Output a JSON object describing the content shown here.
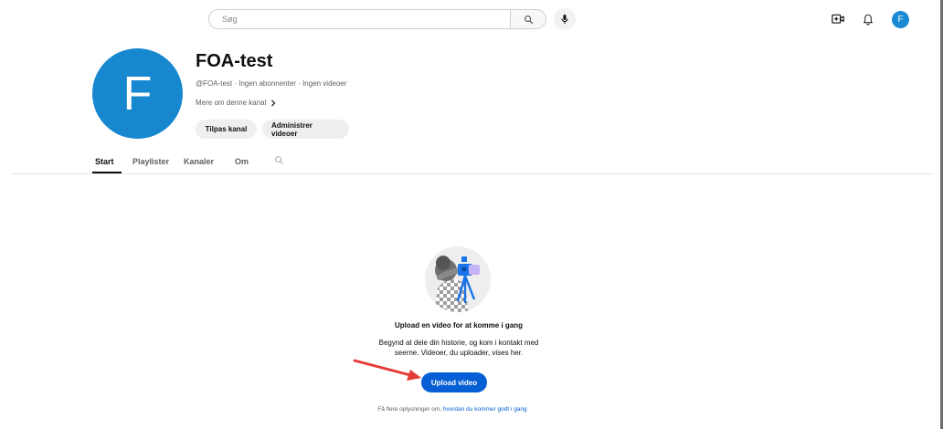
{
  "colors": {
    "accent": "#065fd4",
    "avatar": "#1787d0",
    "annotation_arrow": "#e53935"
  },
  "topbar": {
    "search_placeholder": "Søg",
    "search_icon": "search-icon",
    "mic_icon": "microphone-icon",
    "create_icon": "create-video-icon",
    "notifications_icon": "bell-icon",
    "avatar_letter": "F"
  },
  "channel": {
    "avatar_letter": "F",
    "name": "FOA-test",
    "meta": "@FOA-test · Ingen abonnenter · Ingen videoer",
    "more_label": "Mere om denne kanal",
    "customize_label": "Tilpas kanal",
    "manage_label": "Administrer videoer"
  },
  "tabs": {
    "start": "Start",
    "playlists": "Playlister",
    "channels": "Kanaler",
    "about": "Om",
    "active": "Start"
  },
  "empty_state": {
    "title": "Upload en video for at komme i gang",
    "description_line1": "Begynd at dele din historie, og kom i kontakt med",
    "description_line2": "seerne. Videoer, du uploader, vises her.",
    "upload_label": "Upload video",
    "footer_prefix": "Få flere oplysninger om,",
    "footer_link": "hvordan du kommer godt i gang"
  }
}
